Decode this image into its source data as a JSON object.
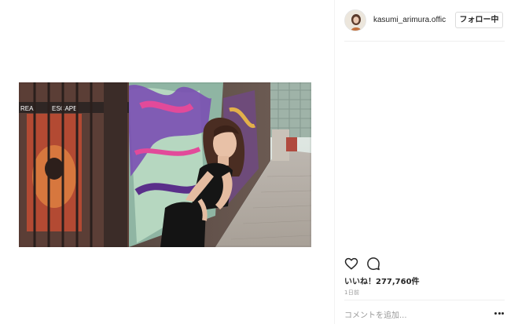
{
  "post": {
    "username": "kasumi_arimura.offic",
    "follow_label": "フォロー中",
    "likes": "いいね！277,760件",
    "time_ago": "1日前",
    "comment_placeholder": "コメントを追加...",
    "icons": {
      "avatar": "profile-photo",
      "like": "heart-outline-icon",
      "comment": "speech-bubble-icon",
      "more": "ellipsis-icon"
    }
  },
  "colors": {
    "text": "#262626",
    "muted": "#999999",
    "border": "#dbdbdb"
  }
}
